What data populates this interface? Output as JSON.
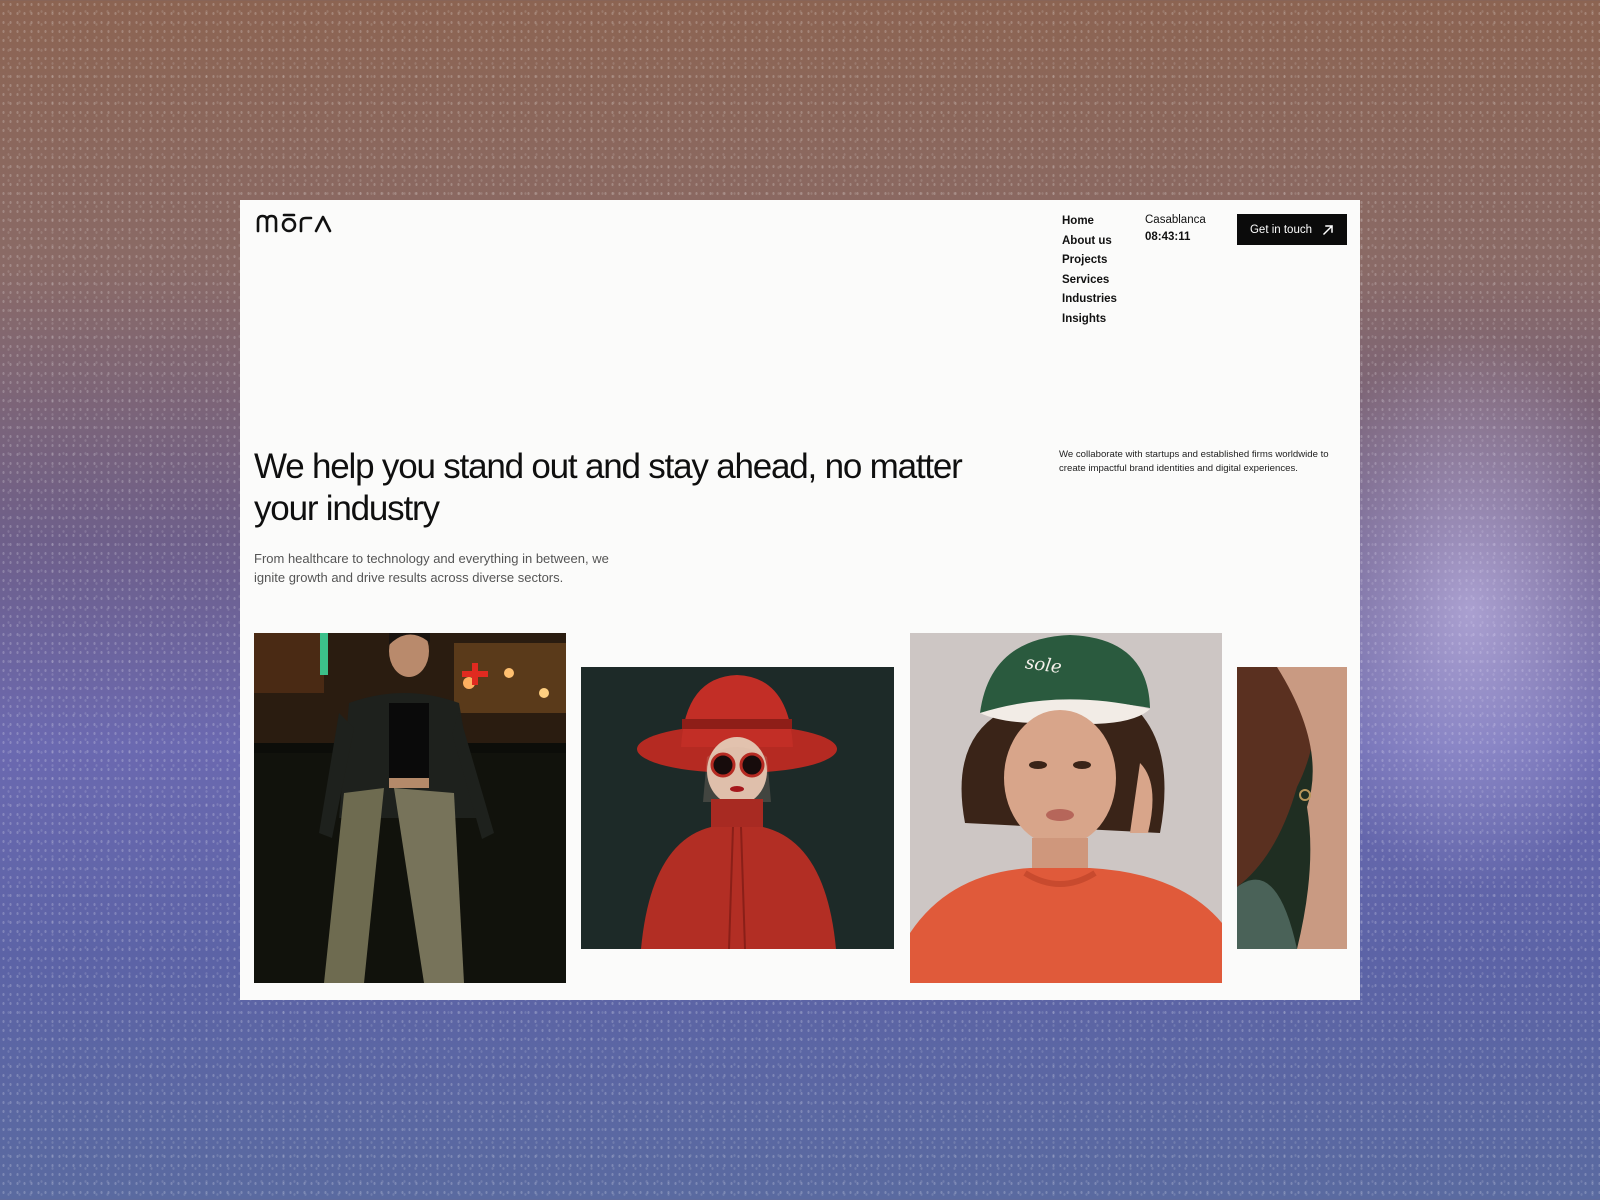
{
  "brand": {
    "logo_text": "Mōrā"
  },
  "nav": {
    "items": [
      {
        "label": "Home"
      },
      {
        "label": "About us"
      },
      {
        "label": "Projects"
      },
      {
        "label": "Services"
      },
      {
        "label": "Industries"
      },
      {
        "label": "Insights"
      }
    ]
  },
  "location": {
    "city": "Casablanca",
    "time": "08:43:11"
  },
  "cta": {
    "label": "Get in touch",
    "icon": "arrow-up-right-icon"
  },
  "hero": {
    "title": "We help you stand out and stay ahead, no matter your industry",
    "subtitle": "From healthcare to technology and everything in between, we ignite growth and drive results across diverse sectors."
  },
  "side_note": "We collaborate with startups and established firms worldwide to create impactful brand identities and digital experiences.",
  "gallery": [
    {
      "name": "photo-woman-leather-jacket-night-street"
    },
    {
      "name": "photo-woman-red-hat-sunglasses"
    },
    {
      "name": "photo-woman-green-cap-orange-sweater"
    },
    {
      "name": "photo-woman-profile-cropped"
    }
  ],
  "colors": {
    "cta_bg": "#0b0b0b",
    "page_bg": "#fbfbfa",
    "text": "#0f0f0f"
  }
}
